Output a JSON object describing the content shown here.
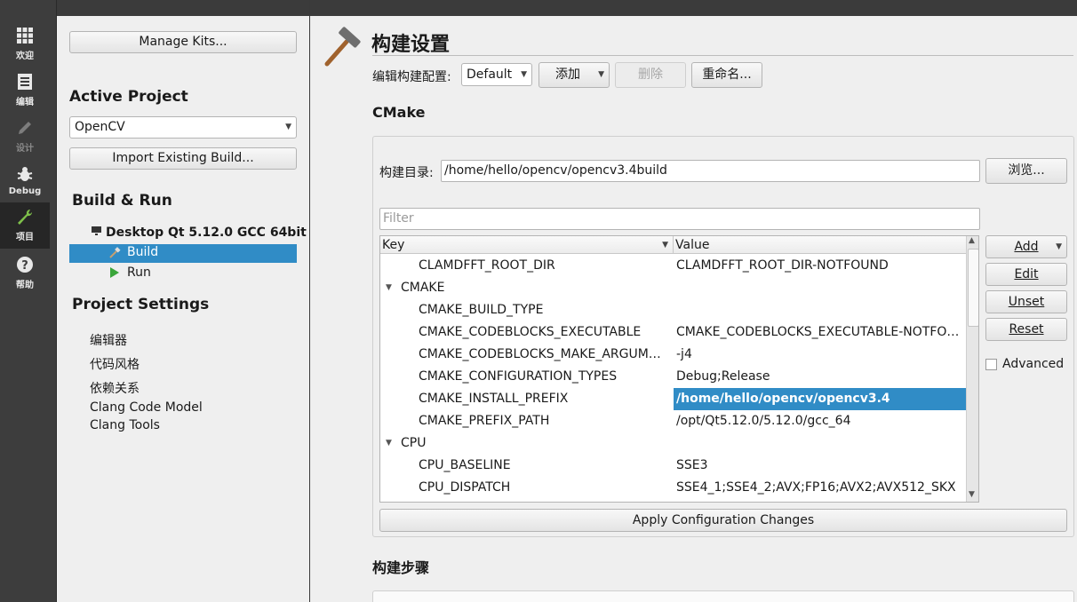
{
  "modebar": {
    "items": [
      {
        "label": "欢迎",
        "icon": "grid-icon"
      },
      {
        "label": "编辑",
        "icon": "document-icon"
      },
      {
        "label": "设计",
        "icon": "pencil-icon"
      },
      {
        "label": "Debug",
        "icon": "bug-icon"
      },
      {
        "label": "项目",
        "icon": "wrench-icon"
      },
      {
        "label": "帮助",
        "icon": "help-icon"
      }
    ]
  },
  "sidebar": {
    "manage_kits": "Manage Kits...",
    "active_project_heading": "Active Project",
    "project_value": "OpenCV",
    "import_build": "Import Existing Build...",
    "build_run_heading": "Build & Run",
    "kit_name": "Desktop Qt 5.12.0 GCC 64bit",
    "build_label": "Build",
    "run_label": "Run",
    "project_settings_heading": "Project Settings",
    "settings_items": [
      "编辑器",
      "代码风格",
      "依赖关系",
      "Clang Code Model",
      "Clang Tools"
    ]
  },
  "main": {
    "title": "构建设置",
    "edit_config_label": "编辑构建配置:",
    "config_value": "Default",
    "add_label": "添加",
    "delete_label": "删除",
    "rename_label": "重命名...",
    "cmake_heading": "CMake",
    "build_dir_label": "构建目录:",
    "build_dir_value": "/home/hello/opencv/opencv3.4build",
    "browse_label": "浏览...",
    "filter_placeholder": "Filter",
    "col_key": "Key",
    "col_value": "Value",
    "rows": [
      {
        "key": "CLAMDFFT_ROOT_DIR",
        "value": "CLAMDFFT_ROOT_DIR-NOTFOUND"
      },
      {
        "key": "CMAKE",
        "value": ""
      },
      {
        "key": "CMAKE_BUILD_TYPE",
        "value": ""
      },
      {
        "key": "CMAKE_CODEBLOCKS_EXECUTABLE",
        "value": "CMAKE_CODEBLOCKS_EXECUTABLE-NOTFO…"
      },
      {
        "key": "CMAKE_CODEBLOCKS_MAKE_ARGUM…",
        "value": "-j4"
      },
      {
        "key": "CMAKE_CONFIGURATION_TYPES",
        "value": "Debug;Release"
      },
      {
        "key": "CMAKE_INSTALL_PREFIX",
        "value": "/home/hello/opencv/opencv3.4"
      },
      {
        "key": "CMAKE_PREFIX_PATH",
        "value": "/opt/Qt5.12.0/5.12.0/gcc_64"
      },
      {
        "key": "CPU",
        "value": ""
      },
      {
        "key": "CPU_BASELINE",
        "value": "SSE3"
      },
      {
        "key": "CPU_DISPATCH",
        "value": "SSE4_1;SSE4_2;AVX;FP16;AVX2;AVX512_SKX"
      }
    ],
    "add_btn": "Add",
    "edit_btn": "Edit",
    "unset_btn": "Unset",
    "reset_btn": "Reset",
    "advanced_label": "Advanced",
    "apply_label": "Apply Configuration Changes",
    "build_steps_heading": "构建步骤"
  }
}
